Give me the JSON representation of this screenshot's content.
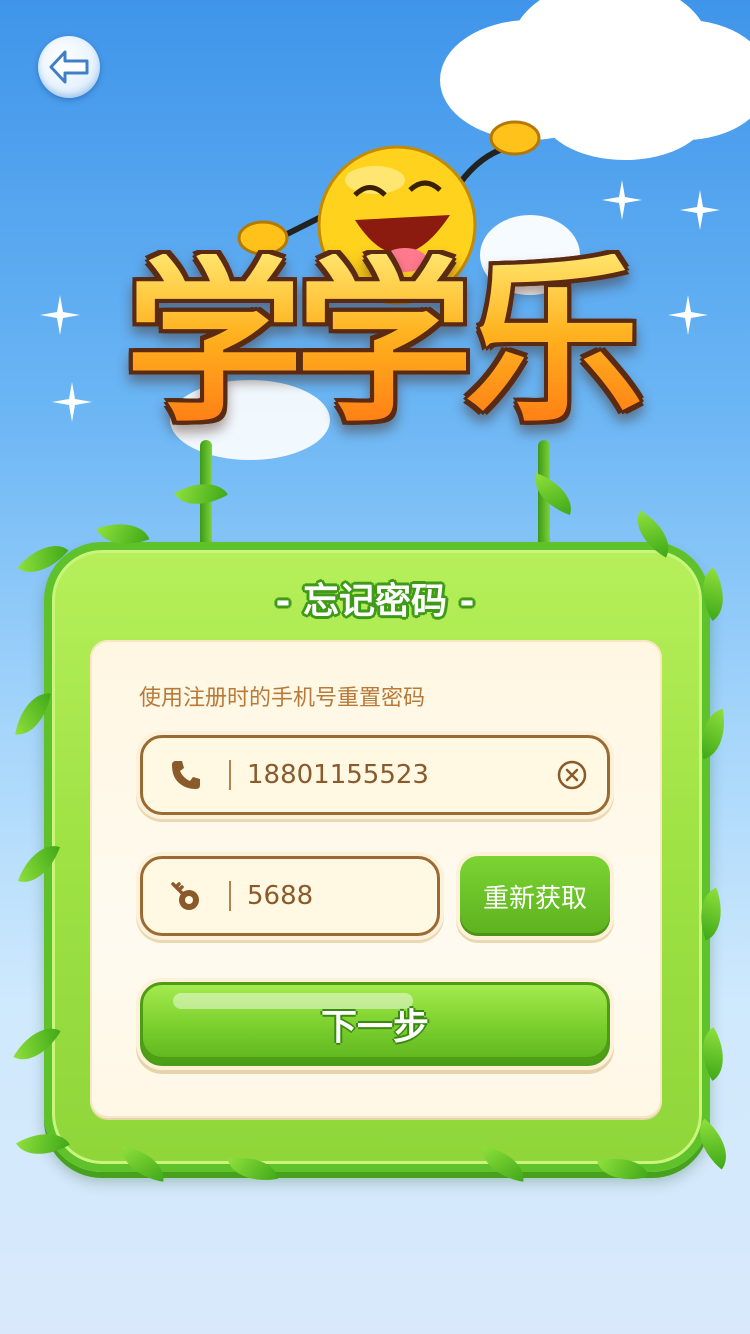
{
  "app": {
    "logo_text": "学学乐"
  },
  "header": {
    "back_icon": "back-arrow-icon"
  },
  "board": {
    "title": "- 忘记密码 -",
    "hint": "使用注册时的手机号重置密码",
    "phone": {
      "value": "18801155523",
      "icon": "phone-icon",
      "clear_icon": "clear-circle-icon"
    },
    "code": {
      "value": "5688",
      "icon": "key-icon"
    },
    "resend_label": "重新获取",
    "next_label": "下一步"
  },
  "colors": {
    "primary_green": "#5db11e",
    "text_brown": "#8a5a2b",
    "hint_brown": "#b87a3a"
  }
}
